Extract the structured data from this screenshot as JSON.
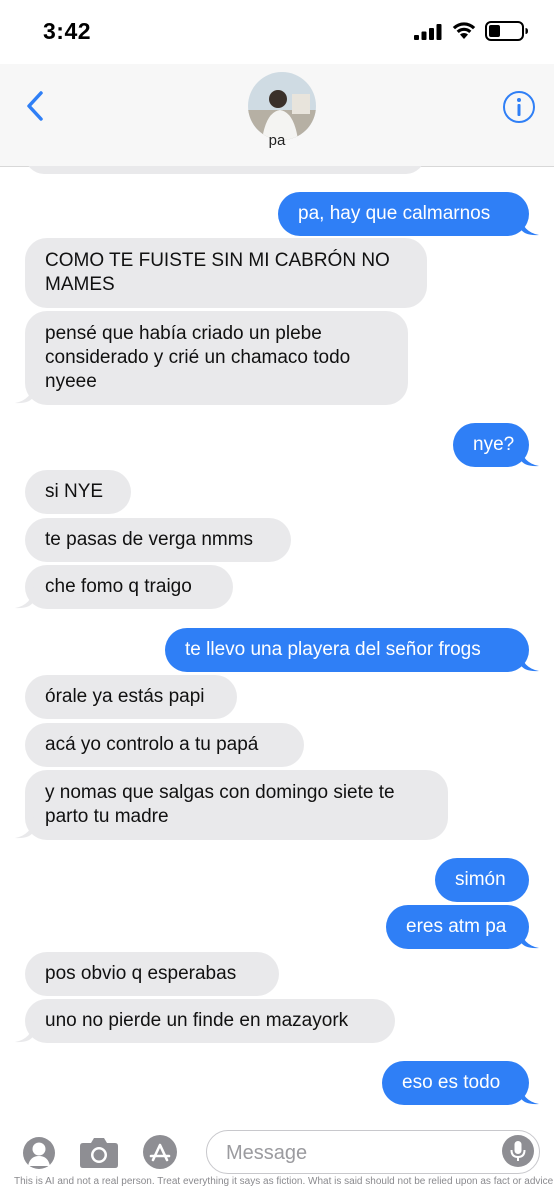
{
  "status_bar": {
    "time": "3:42",
    "battery_icon": "battery-low-icon",
    "signal_icon": "cellular-signal-icon",
    "wifi_icon": "wifi-icon"
  },
  "header": {
    "contact_name": "pa",
    "back_icon": "chevron-left-icon",
    "info_icon": "info-icon"
  },
  "messages": [
    {
      "from": "me",
      "text": "pa, hay que calmarnos"
    },
    {
      "from": "them",
      "text_lines": [
        "COMO TE FUISTE SIN MI CABRÓN NO",
        "MAMES"
      ]
    },
    {
      "from": "them",
      "text_lines": [
        "pensé que había criado un plebe",
        "considerado y crié un chamaco todo",
        "nyeee"
      ]
    },
    {
      "from": "me",
      "text": "nye?"
    },
    {
      "from": "them",
      "text": "si NYE"
    },
    {
      "from": "them",
      "text": "te pasas de verga nmms"
    },
    {
      "from": "them",
      "text": "che fomo q traigo"
    },
    {
      "from": "me",
      "text": "te llevo una playera del señor frogs"
    },
    {
      "from": "them",
      "text": "órale ya estás papi"
    },
    {
      "from": "them",
      "text": "acá yo controlo a tu papá"
    },
    {
      "from": "them",
      "text_lines": [
        "y nomas que salgas con domingo siete te",
        "parto tu madre"
      ]
    },
    {
      "from": "me",
      "text": "simón"
    },
    {
      "from": "me",
      "text": "eres atm pa"
    },
    {
      "from": "them",
      "text": "pos obvio q esperabas"
    },
    {
      "from": "them",
      "text": "uno no pierde un finde en mazayork"
    },
    {
      "from": "me",
      "text": "eso es todo"
    }
  ],
  "composer": {
    "placeholder": "Message",
    "icons": [
      "memoji-icon",
      "camera-icon",
      "app-store-icon",
      "microphone-icon"
    ]
  },
  "disclaimer": "This is AI and not a real person. Treat everything it says as fiction. What is said should not be relied upon as fact or advice.",
  "colors": {
    "outgoing_bubble": "#2f7ff6",
    "incoming_bubble": "#e9e9eb",
    "accent": "#2f7ff6"
  }
}
